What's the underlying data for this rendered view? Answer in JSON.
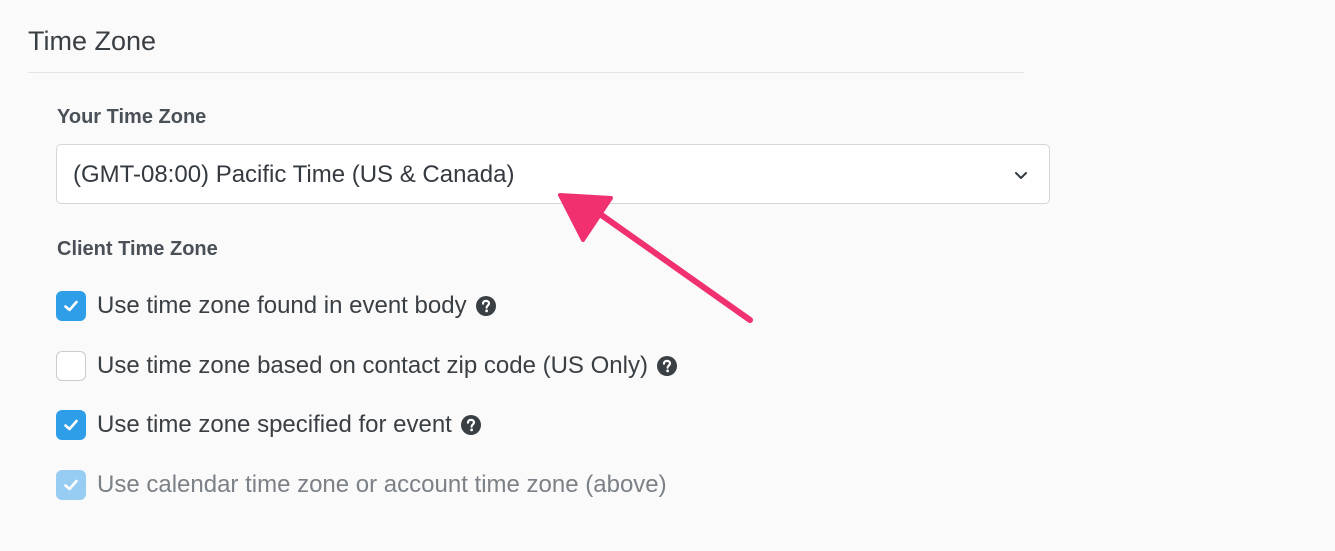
{
  "section": {
    "title": "Time Zone"
  },
  "your_time_zone": {
    "label": "Your Time Zone",
    "selected_value": "(GMT-08:00) Pacific Time (US & Canada)"
  },
  "client_time_zone": {
    "label": "Client Time Zone",
    "options": [
      {
        "label": "Use time zone found in event body",
        "checked": true,
        "disabled": false,
        "has_help": true
      },
      {
        "label": "Use time zone based on contact zip code (US Only)",
        "checked": false,
        "disabled": false,
        "has_help": true
      },
      {
        "label": "Use time zone specified for event",
        "checked": true,
        "disabled": false,
        "has_help": true
      },
      {
        "label": "Use calendar time zone or account time zone (above)",
        "checked": true,
        "disabled": true,
        "has_help": false
      }
    ]
  },
  "icons": {
    "dropdown": "chevron-down-icon",
    "help": "question-circle-icon",
    "check": "checkmark-icon",
    "annotation": "arrow-icon"
  },
  "colors": {
    "checkbox_checked": "#2f9ee8",
    "checkbox_disabled": "#98cdf3",
    "annotation_arrow": "#f0306f"
  }
}
